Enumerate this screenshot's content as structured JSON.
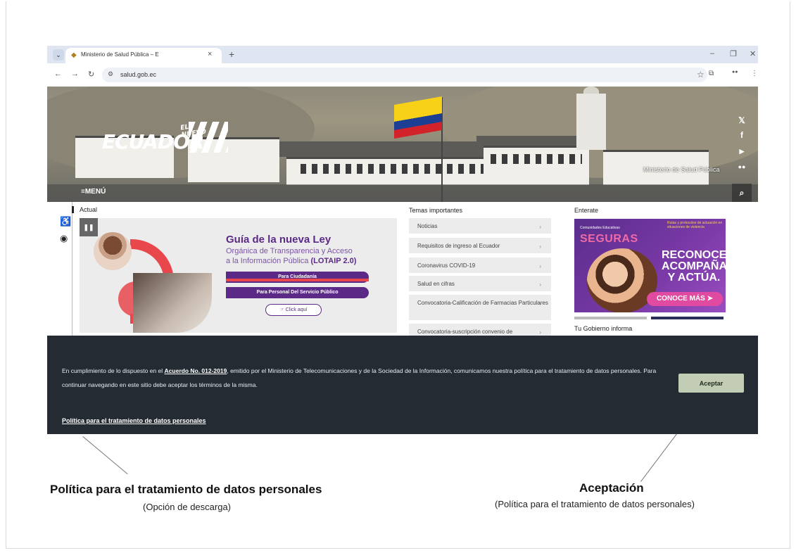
{
  "browser": {
    "tab_title": "Ministerio de Salud Pública – E",
    "url": "salud.gob.ec"
  },
  "hero": {
    "logo_small": "EL NUEVO",
    "logo_main": "ECUADOR",
    "menu_label": "MENÚ",
    "ministry_label": "Ministerio de Salud Pública",
    "social": [
      "x-icon",
      "facebook-icon",
      "youtube-icon",
      "flickr-icon",
      "search-icon"
    ]
  },
  "actual": {
    "title": "Actual",
    "banner": {
      "title": "Guía de la nueva Ley",
      "subtitle_line1": "Orgánica de Transparencia y Acceso",
      "subtitle_line2": "a la Información Pública",
      "subtitle_bold": "(LOTAIP 2.0)",
      "btn_citizens": "Para Ciudadanía",
      "btn_public": "Para Personal Del Servicio Público",
      "btn_click": "Click aquí"
    }
  },
  "temas": {
    "title": "Temas importantes",
    "items": [
      "Noticias",
      "Requisitos de ingreso al Ecuador",
      "Coronavirus COVID-19",
      "Salud en cifras",
      "Convocatoria-Calificación de Farmacias Particulares",
      "Convocatoria-suscripción convenio de"
    ]
  },
  "enterate": {
    "title": "Enterate",
    "poster_line1": "Comunidades Educativas",
    "poster_seguras": "SEGURAS",
    "poster_right": "Rutas y protocolos de actuación en situaciones de violencia",
    "poster_big": "RECONOCE, ACOMPAÑA Y ACTÚA.",
    "poster_btn": "CONOCE MÁS",
    "gov_title": "Tu Gobierno informa"
  },
  "cookie": {
    "text_before": "En cumplimiento de lo dispuesto en el ",
    "link": "Acuerdo No. 012-2019",
    "text_after": ", emitido por el Ministerio de Telecomunicaciones y de la Sociedad de la Información, comunicamos nuestra política para el tratamiento de datos personales. Para continuar navegando en este sitio debe aceptar los términos de la misma.",
    "accept": "Aceptar",
    "policy": "Política para el tratamiento de datos personales"
  },
  "annotations": {
    "left_title": "Política para el tratamiento de datos personales",
    "left_sub": "(Opción de descarga)",
    "right_title": "Aceptación",
    "right_sub": "(Política para el tratamiento de datos personales)"
  },
  "colors": {
    "accent_purple": "#5b2a86",
    "cookie_bg": "#242b33",
    "accept_bg": "#c3ccb4"
  }
}
